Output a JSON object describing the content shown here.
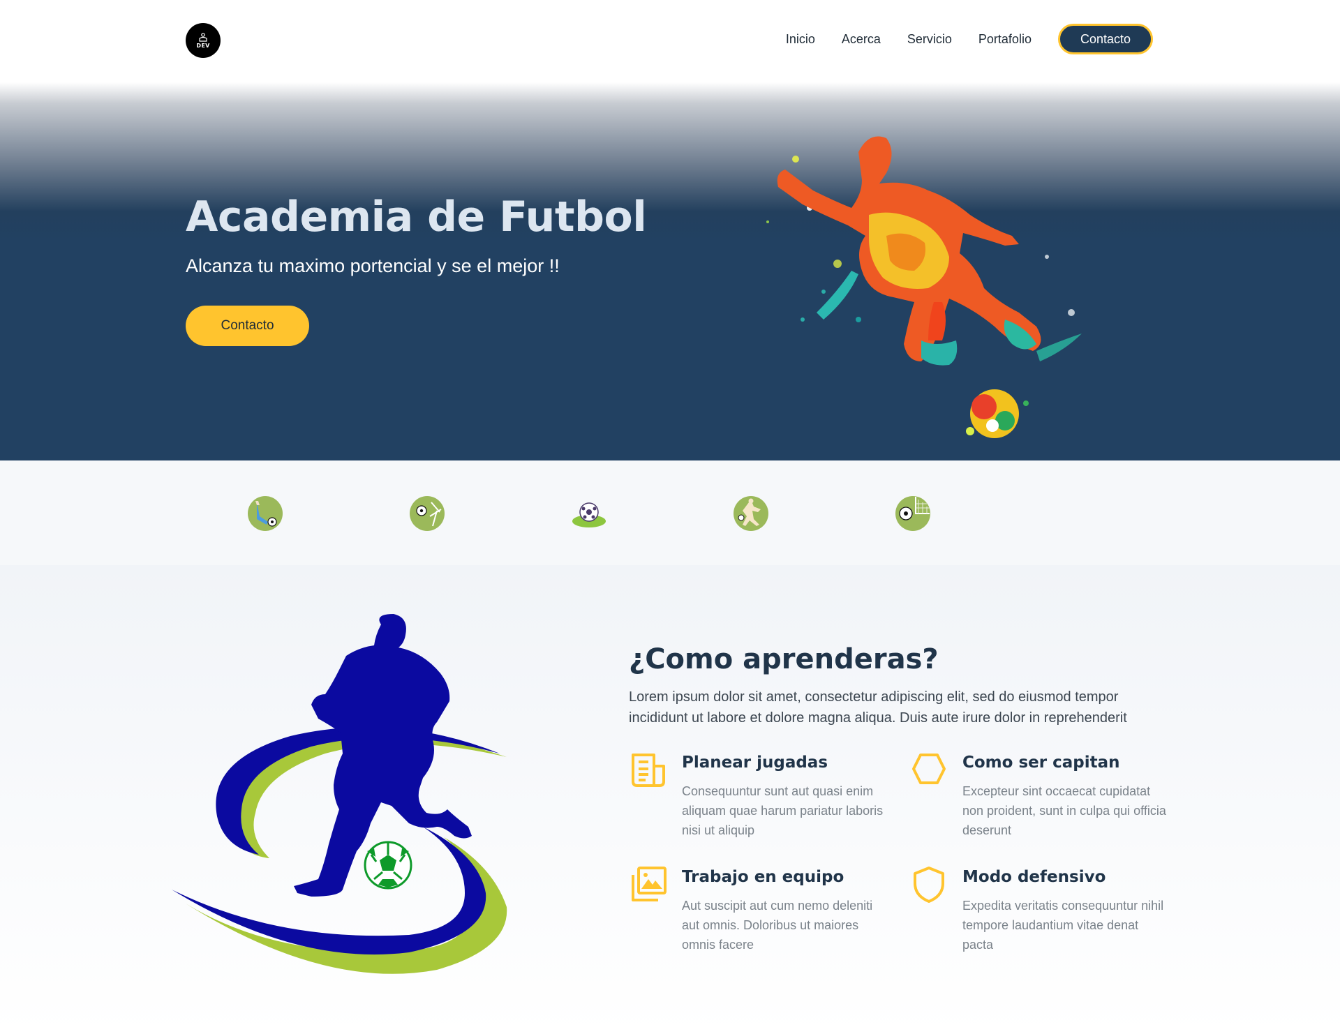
{
  "header": {
    "logo_text": "DEV",
    "nav": [
      "Inicio",
      "Acerca",
      "Servicio",
      "Portafolio"
    ],
    "cta_label": "Contacto"
  },
  "hero": {
    "title": "Academia de Futbol",
    "subtitle": "Alcanza tu maximo portencial y se el mejor !!",
    "button_label": "Contacto"
  },
  "strip": {
    "icons": [
      "player-kick-icon",
      "soccer-ball-net-icon",
      "soccer-ball-icon",
      "player-dribble-icon",
      "soccer-ball-goal-icon"
    ]
  },
  "about": {
    "title": "¿Como aprenderas?",
    "text": "Lorem ipsum dolor sit amet, consectetur adipiscing elit, sed do eiusmod tempor incididunt ut labore et dolore magna aliqua. Duis aute irure dolor in reprehenderit",
    "features": [
      {
        "icon": "document-icon",
        "title": "Planear jugadas",
        "desc": "Consequuntur sunt aut quasi enim aliquam quae harum pariatur laboris nisi ut aliquip"
      },
      {
        "icon": "cube-icon",
        "title": "Como ser capitan",
        "desc": "Excepteur sint occaecat cupidatat non proident, sunt in culpa qui officia deserunt"
      },
      {
        "icon": "images-icon",
        "title": "Trabajo en equipo",
        "desc": "Aut suscipit aut cum nemo deleniti aut omnis. Doloribus ut maiores omnis facere"
      },
      {
        "icon": "shield-icon",
        "title": "Modo defensivo",
        "desc": "Expedita veritatis consequuntur nihil tempore laudantium vitae denat pacta"
      }
    ]
  },
  "colors": {
    "navy": "#224162",
    "accent": "#ffc42e",
    "heading": "#203449",
    "royal_blue": "#0b0aa0",
    "lime": "#a8c83a"
  }
}
